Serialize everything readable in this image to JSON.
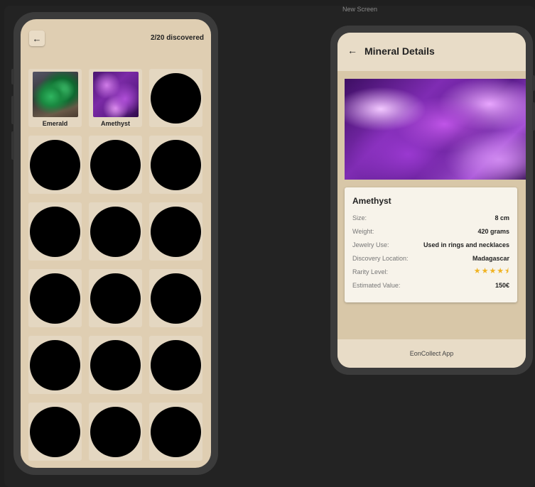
{
  "canvas_label": "New Screen",
  "collection": {
    "progress_text": "2/20 discovered",
    "discovered_count": 2,
    "total_count": 20,
    "items": [
      {
        "name": "Emerald",
        "discovered": true,
        "image": "emerald"
      },
      {
        "name": "Amethyst",
        "discovered": true,
        "image": "amethyst"
      },
      {
        "name": "",
        "discovered": false
      },
      {
        "name": "",
        "discovered": false
      },
      {
        "name": "",
        "discovered": false
      },
      {
        "name": "",
        "discovered": false
      },
      {
        "name": "",
        "discovered": false
      },
      {
        "name": "",
        "discovered": false
      },
      {
        "name": "",
        "discovered": false
      },
      {
        "name": "",
        "discovered": false
      },
      {
        "name": "",
        "discovered": false
      },
      {
        "name": "",
        "discovered": false
      },
      {
        "name": "",
        "discovered": false
      },
      {
        "name": "",
        "discovered": false
      },
      {
        "name": "",
        "discovered": false
      },
      {
        "name": "",
        "discovered": false
      },
      {
        "name": "",
        "discovered": false
      },
      {
        "name": "",
        "discovered": false
      }
    ]
  },
  "details": {
    "title": "Mineral Details",
    "mineral_name": "Amethyst",
    "rows": [
      {
        "label": "Size:",
        "value": "8 cm"
      },
      {
        "label": "Weight:",
        "value": "420 grams"
      },
      {
        "label": "Jewelry Use:",
        "value": "Used in rings and necklaces"
      },
      {
        "label": "Discovery Location:",
        "value": "Madagascar"
      },
      {
        "label": "Rarity Level:",
        "value": "",
        "stars": 4.5
      },
      {
        "label": "Estimated Value:",
        "value": "150€"
      }
    ],
    "footer": "EonCollect App"
  },
  "colors": {
    "background": "#1f1f1f",
    "screen_beige": "#dfceb2",
    "star": "#f0b323"
  }
}
